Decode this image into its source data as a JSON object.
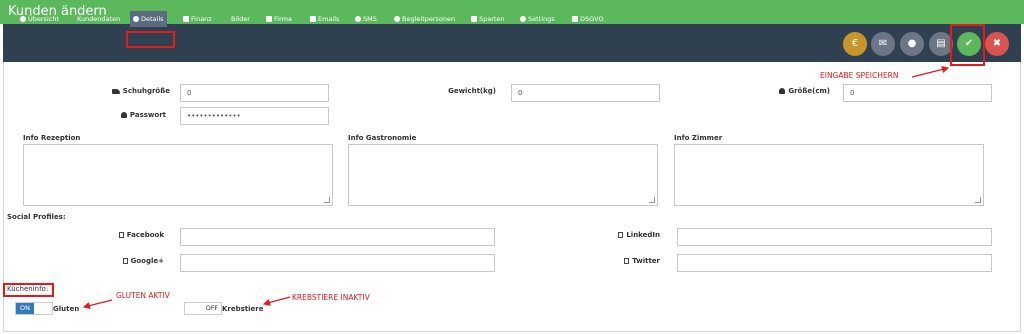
{
  "window": {
    "title": "Kunden ändern"
  },
  "nav": {
    "items": [
      {
        "label": "Übersicht",
        "icon": "person-icon"
      },
      {
        "label": "Kundendaten",
        "icon": ""
      },
      {
        "label": "Details",
        "icon": "info-icon",
        "active": true
      },
      {
        "label": "Finanz",
        "icon": "shield-icon"
      },
      {
        "label": "Bilder",
        "icon": ""
      },
      {
        "label": "Firma",
        "icon": "building-icon"
      },
      {
        "label": "Emails",
        "icon": "envelope-icon"
      },
      {
        "label": "SMS",
        "icon": "chat-icon"
      },
      {
        "label": "Begleitpersonen",
        "icon": "group-icon"
      },
      {
        "label": "Sparten",
        "icon": "file-icon"
      },
      {
        "label": "Settings",
        "icon": "gears-icon"
      },
      {
        "label": "DSGVO",
        "icon": "shield-icon"
      }
    ],
    "actions": {
      "euro_glyph": "€",
      "mail_glyph": "✉",
      "chat_glyph": "●",
      "print_glyph": "▤",
      "save_glyph": "✔",
      "cancel_glyph": "✖"
    }
  },
  "annotations": {
    "save": "EINGABE SPEICHERN",
    "gluten": "GLUTEN AKTIV",
    "krebstiere": "KREBSTIERE INAKTIV"
  },
  "form": {
    "schuhgroesse": {
      "label": "Schuhgröße",
      "value": "0"
    },
    "gewicht": {
      "label": "Gewicht(kg)",
      "value": "0"
    },
    "groesse": {
      "label": "Größe(cm)",
      "value": "0"
    },
    "passwort": {
      "label": "Passwort",
      "value": "•••••••••••••"
    },
    "info_rezeption": {
      "label": "Info Rezeption"
    },
    "info_gastronomie": {
      "label": "Info Gastronomie"
    },
    "info_zimmer": {
      "label": "Info Zimmer"
    },
    "social_title": "Social Profiles:",
    "facebook": {
      "label": "Facebook",
      "value": ""
    },
    "linkedin": {
      "label": "LinkedIn",
      "value": ""
    },
    "google": {
      "label": "Google+",
      "value": ""
    },
    "twitter": {
      "label": "Twitter",
      "value": ""
    },
    "kuechen_title": "Kücheninfo:",
    "gluten": {
      "label": "Gluten",
      "state": "ON"
    },
    "krebstiere": {
      "label": "Krebstiere",
      "state": "OFF"
    }
  },
  "colors": {
    "titlebar": "#5cb85c",
    "navbar": "#2f4050",
    "annotation": "#e3191b",
    "toggle_on": "#337ab7"
  }
}
